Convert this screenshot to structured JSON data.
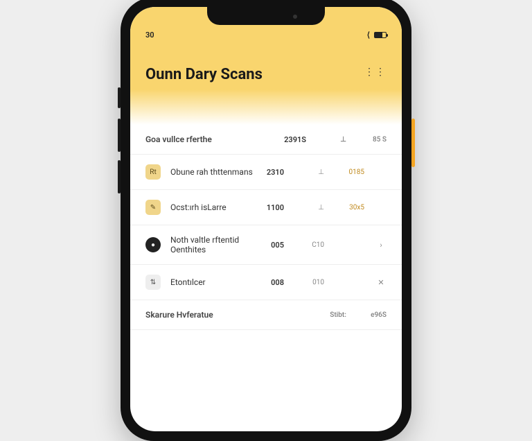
{
  "status": {
    "left": "30",
    "signal_icon": "⟨",
    "battery_pct": 70
  },
  "header": {
    "title": "Ounn Dary Scans",
    "menu_icon": "⋮⋮"
  },
  "section": {
    "label": "Goa vullce rferthe",
    "cols": [
      "2391S",
      "⊥",
      "85 S"
    ]
  },
  "rows": [
    {
      "icon": "Rt",
      "style": "gold",
      "label": "Obune rah thttenmans",
      "cols": [
        "2310",
        "⊥",
        "0185"
      ],
      "action": ""
    },
    {
      "icon": "✎",
      "style": "gold",
      "label": "Ocst:ırh isLarre",
      "cols": [
        "1100",
        "⊥",
        "30x5"
      ],
      "action": ""
    },
    {
      "icon": "●",
      "style": "dark",
      "label": "Noth valtle rftentid Oenthites",
      "cols": [
        "005",
        "C10",
        ""
      ],
      "action": "›"
    },
    {
      "icon": "⇅",
      "style": "plain",
      "label": "Etontılcer",
      "cols": [
        "008",
        "010",
        ""
      ],
      "action": "✕"
    }
  ],
  "footer": {
    "label": "Skarure Hvferatue",
    "cols": [
      "Stibt:",
      "e96S"
    ]
  }
}
